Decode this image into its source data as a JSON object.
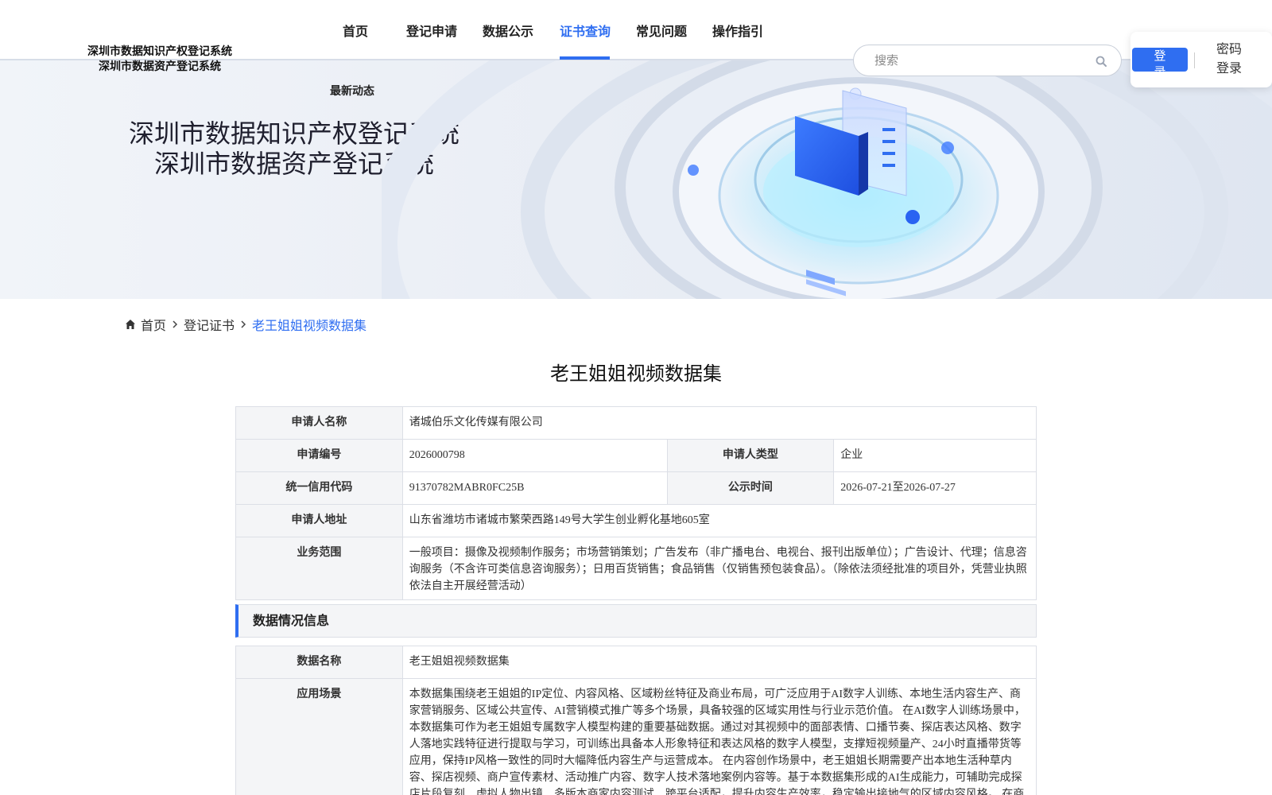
{
  "header": {
    "logo_line1": "深圳市数据知识产权登记系统",
    "logo_line2": "深圳市数据资产登记系统",
    "nav": [
      {
        "label": "首页"
      },
      {
        "label": "登记申请"
      },
      {
        "label": "数据公示"
      },
      {
        "label": "证书查询"
      },
      {
        "label": "常见问题"
      },
      {
        "label": "操作指引"
      }
    ],
    "active_nav": "证书查询",
    "subnav_label": "最新动态",
    "search_placeholder": "搜索",
    "login_label": "登录",
    "password_login_label": "密码登录"
  },
  "banner": {
    "title_line1": "深圳市数据知识产权登记系统",
    "title_line2": "深圳市数据资产登记系统"
  },
  "breadcrumb": {
    "home": "首页",
    "level1": "登记证书",
    "current": "老王姐姐视频数据集"
  },
  "page_title": "老王姐姐视频数据集",
  "applicant": {
    "name_label": "申请人名称",
    "name": "诸城伯乐文化传媒有限公司",
    "number_label": "申请编号",
    "number": "2026000798",
    "type_label": "申请人类型",
    "type": "企业",
    "credit_code_label": "统一信用代码",
    "credit_code": "91370782MABR0FC25B",
    "publicity_label": "公示时间",
    "publicity_period": "2026-07-21至2026-07-27",
    "address_label": "申请人地址",
    "address": "山东省潍坊市诸城市繁荣西路149号大学生创业孵化基地605室",
    "scope_label": "业务范围",
    "scope": "一般项目：摄像及视频制作服务；市场营销策划；广告发布（非广播电台、电视台、报刊出版单位）；广告设计、代理；信息咨询服务（不含许可类信息咨询服务）；日用百货销售；食品销售（仅销售预包装食品）。（除依法须经批准的项目外，凭营业执照依法自主开展经营活动）"
  },
  "data_section": {
    "heading": "数据情况信息",
    "data_name_label": "数据名称",
    "data_name": "老王姐姐视频数据集",
    "scenario_label": "应用场景",
    "scenario": "本数据集围绕老王姐姐的IP定位、内容风格、区域粉丝特征及商业布局，可广泛应用于AI数字人训练、本地生活内容生产、商家营销服务、区域公共宣传、AI营销模式推广等多个场景，具备较强的区域实用性与行业示范价值。 在AI数字人训练场景中，本数据集可作为老王姐姐专属数字人模型构建的重要基础数据。通过对其视频中的面部表情、口播节奏、探店表达风格、数字人落地实践特征进行提取与学习，可训练出具备本人形象特征和表达风格的数字人模型，支撑短视频量产、24小时直播带货等应用，保持IP风格一致性的同时大幅降低内容生产与运营成本。 在内容创作场景中，老王姐姐长期需要产出本地生活种草内容、探店视频、商户宣传素材、活动推广内容、数字人技术落地案例内容等。基于本数据集形成的AI生成能力，可辅助完成探店片段复刻、虚拟人物出镜、多版本商家内容测试、跨平台适配，提升内容生产效率，稳定输出接地气的区域内容风格。 在商"
  },
  "colors": {
    "accent": "#2f6ef1",
    "label_bg": "#f4f5f7",
    "border": "#dcdfe6"
  }
}
